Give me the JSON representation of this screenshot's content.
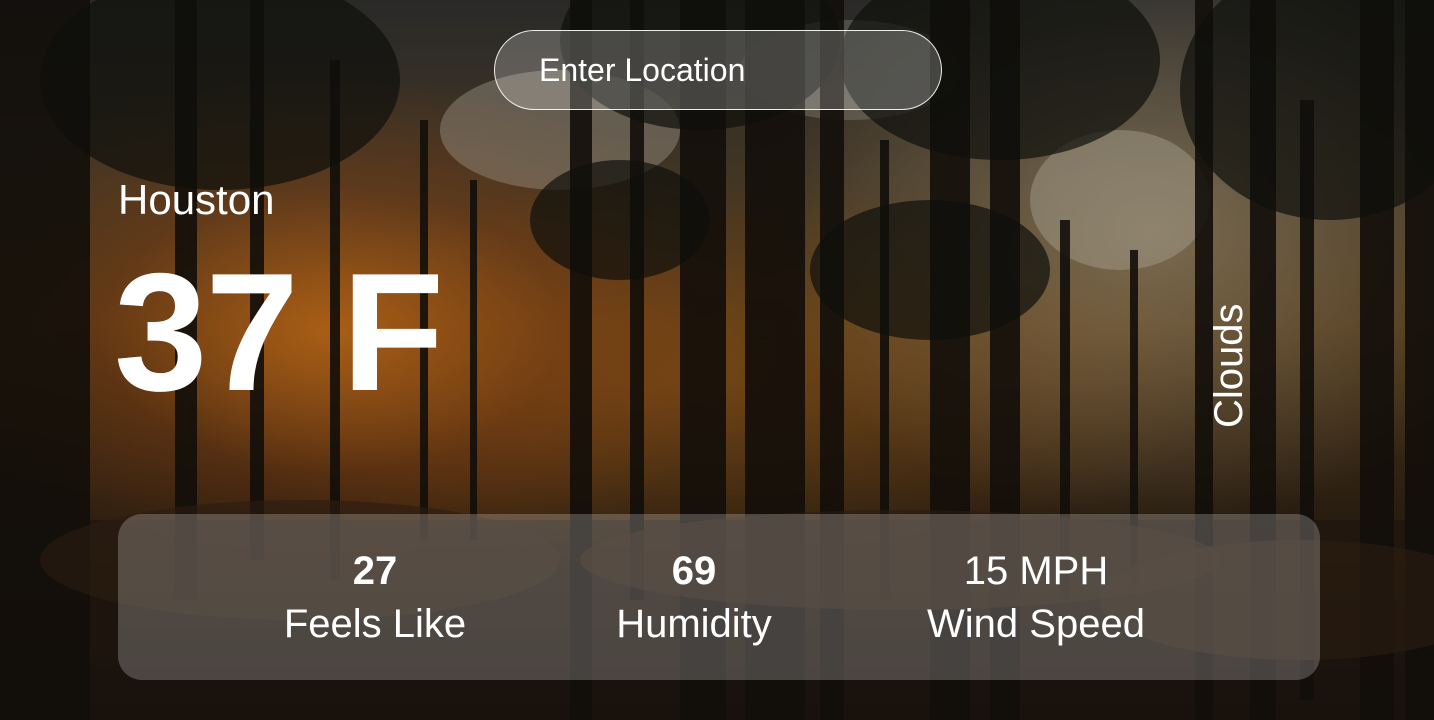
{
  "search": {
    "placeholder": "Enter Location"
  },
  "location": {
    "city": "Houston"
  },
  "current": {
    "temperature": "37 F",
    "condition": "Clouds"
  },
  "stats": {
    "feels_like": {
      "value": "27",
      "label": "Feels Like"
    },
    "humidity": {
      "value": "69",
      "label": "Humidity"
    },
    "wind_speed": {
      "value": "15 MPH",
      "label": "Wind Speed"
    }
  },
  "colors": {
    "text": "#ffffff",
    "panel": "rgba(255,255,255,0.22)",
    "sunlight": "#ff8c1e"
  }
}
